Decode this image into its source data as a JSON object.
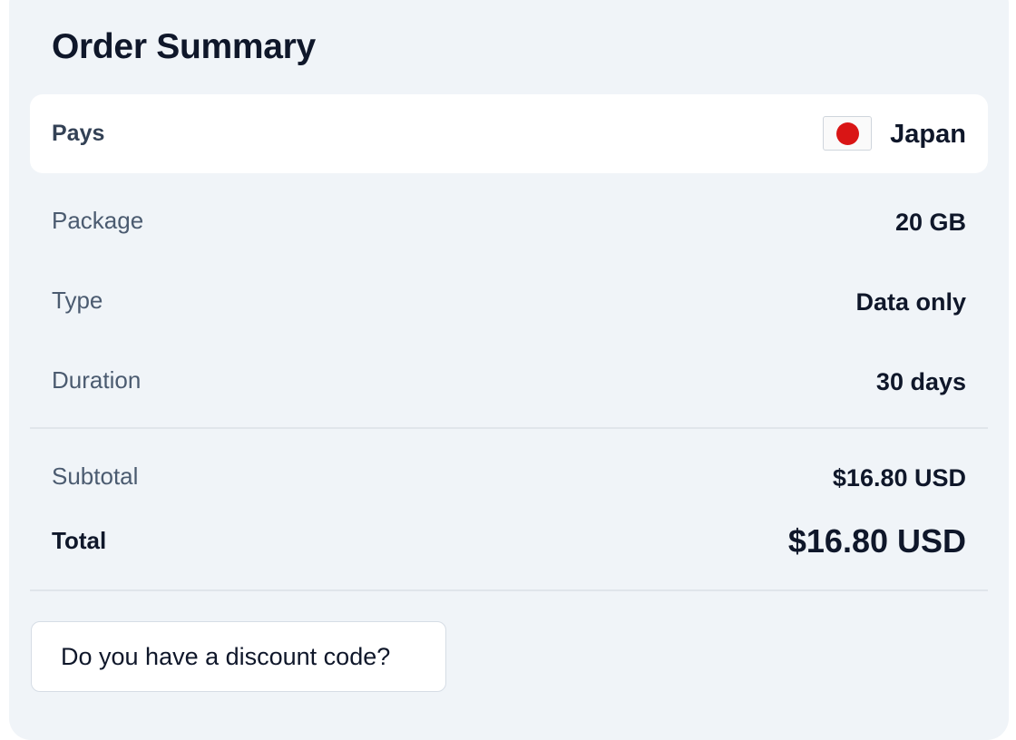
{
  "summary": {
    "title": "Order Summary",
    "country": {
      "label": "Pays",
      "value": "Japan",
      "flag_icon": "japan-flag-icon",
      "flag_color": "#d91515"
    },
    "details": [
      {
        "label": "Package",
        "value": "20 GB"
      },
      {
        "label": "Type",
        "value": "Data only"
      },
      {
        "label": "Duration",
        "value": "30 days"
      }
    ],
    "subtotal": {
      "label": "Subtotal",
      "value": "$16.80 USD"
    },
    "total": {
      "label": "Total",
      "value": "$16.80 USD"
    },
    "discount_button": "Do you have a discount code?"
  }
}
